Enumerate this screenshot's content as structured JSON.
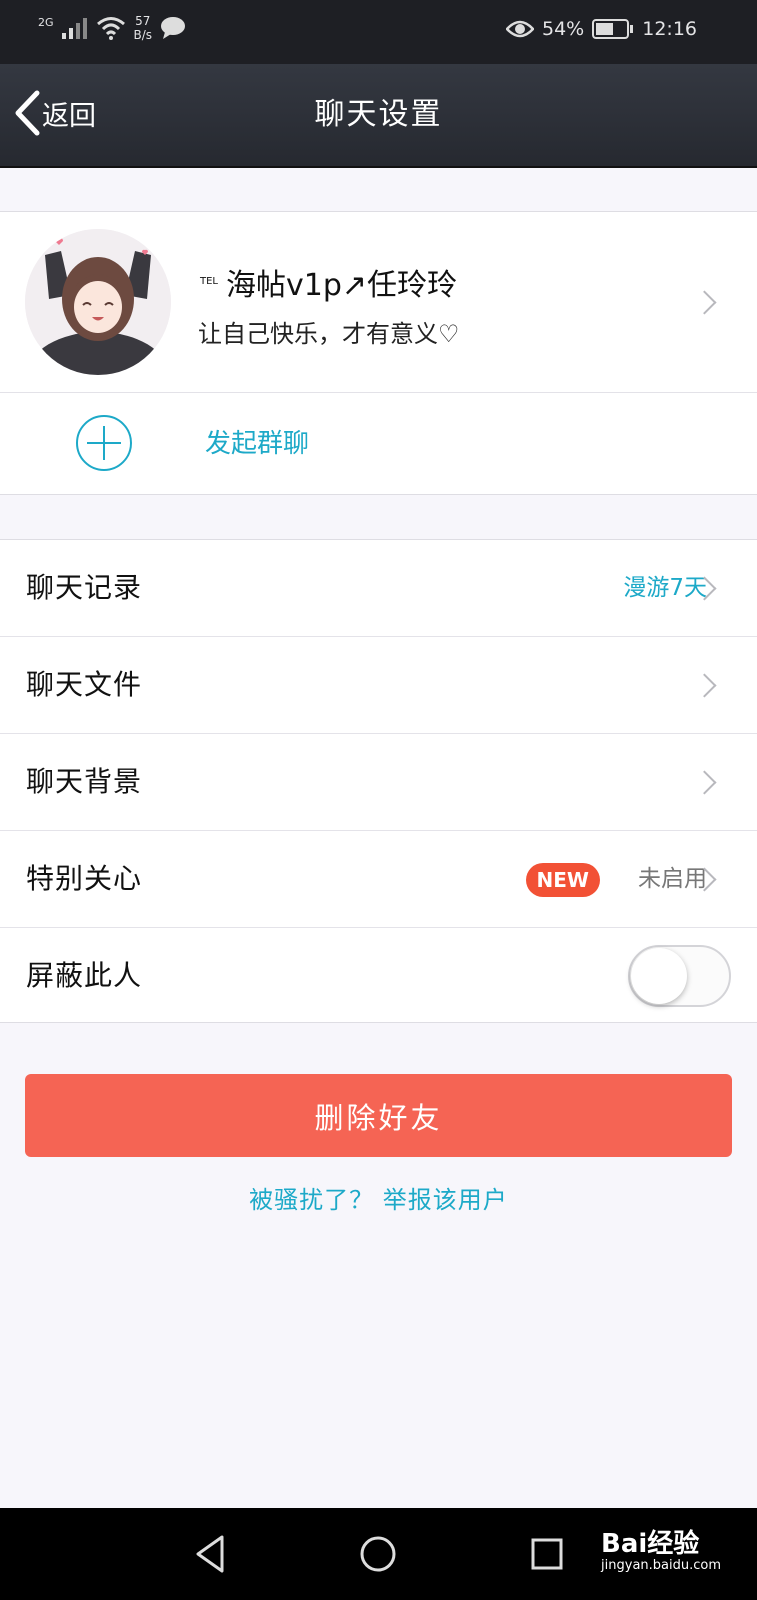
{
  "status_bar": {
    "network": "2G",
    "speed_value": "57",
    "speed_unit": "B/s",
    "battery": "54%",
    "time": "12:16",
    "icons": [
      "signal-icon",
      "wifi-icon",
      "message-icon",
      "eye-icon",
      "battery-icon"
    ]
  },
  "nav": {
    "back_label": "返回",
    "title": "聊天设置"
  },
  "profile": {
    "tel_tag": "TEL",
    "name": "海帖v1p↗任玲玲",
    "signature": "让自己快乐，才有意义♡"
  },
  "group_chat": {
    "label": "发起群聊"
  },
  "settings": [
    {
      "label": "聊天记录",
      "value": "漫游7天",
      "value_color": "#1da9c8"
    },
    {
      "label": "聊天文件",
      "value": ""
    },
    {
      "label": "聊天背景",
      "value": ""
    },
    {
      "label": "特别关心",
      "badge": "NEW",
      "value": "未启用",
      "value_color": "#777777"
    },
    {
      "label": "屏蔽此人",
      "toggle": false
    }
  ],
  "actions": {
    "delete_label": "删除好友",
    "report_text": "被骚扰了？ 举报该用户"
  },
  "watermark": {
    "brand": "Bai经验",
    "url": "jingyan.baidu.com"
  },
  "colors": {
    "accent": "#1da9c8",
    "danger": "#f56454",
    "badge": "#f25135",
    "header": "#2c2f36"
  }
}
